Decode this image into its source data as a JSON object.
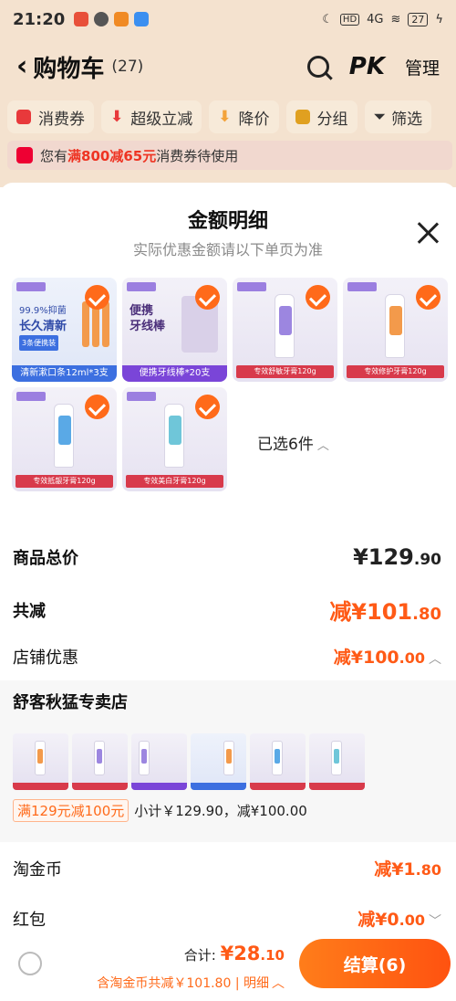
{
  "status_bar": {
    "time": "21:20",
    "network": "4G",
    "battery": "27"
  },
  "header": {
    "title": "购物车",
    "count": "(27)",
    "pk_label": "PK",
    "manage_label": "管理"
  },
  "filters": [
    {
      "label": "消费券",
      "color": "#e8393b"
    },
    {
      "label": "超级立减",
      "color": "#e8393b"
    },
    {
      "label": "降价",
      "color": "#f3a33a"
    },
    {
      "label": "分组",
      "color": "#e0a020"
    },
    {
      "label": "筛选",
      "color": "#333333"
    }
  ],
  "notice": {
    "prefix": "您有",
    "highlight": "满800减65元",
    "suffix": "消费券待使用"
  },
  "sheet": {
    "title": "金额明细",
    "subtitle": "实际优惠金额请以下单页为准",
    "products": [
      {
        "caption": "清新漱口条12ml*3支",
        "line1": "99.9%抑菌",
        "line2": "长久清新",
        "sub": "3条便携装"
      },
      {
        "caption": "便携牙线棒*20支",
        "line1": "便携",
        "line2": "牙线棒"
      },
      {
        "caption": "专效舒敏牙膏120g"
      },
      {
        "caption": "专效修护牙膏120g"
      },
      {
        "caption": "专效抵龈牙膏120g"
      },
      {
        "caption": "专效美白牙膏120g"
      }
    ],
    "selected_label": "已选6件"
  },
  "summary": {
    "total_label": "商品总价",
    "total_int": "¥129",
    "total_dec": ".90",
    "reduce_label": "共减",
    "reduce_int": "减¥101",
    "reduce_dec": ".80",
    "shop_discount_label": "店铺优惠",
    "shop_discount_int": "减¥100",
    "shop_discount_dec": ".00"
  },
  "shop": {
    "name": "舒客秋猛专卖店",
    "promo_tag": "满129元减100元",
    "promo_text": "小计￥129.90，减¥100.00"
  },
  "coins": {
    "label": "淘金币",
    "int": "减¥1",
    "dec": ".80"
  },
  "redpacket": {
    "label": "红包",
    "int": "减¥0",
    "dec": ".00"
  },
  "bottom": {
    "total_prefix": "合计:",
    "total_int": "¥28",
    "total_dec": ".10",
    "discount_text": "含淘金币共减￥101.80 | 明细",
    "checkout_label": "结算(6)"
  }
}
